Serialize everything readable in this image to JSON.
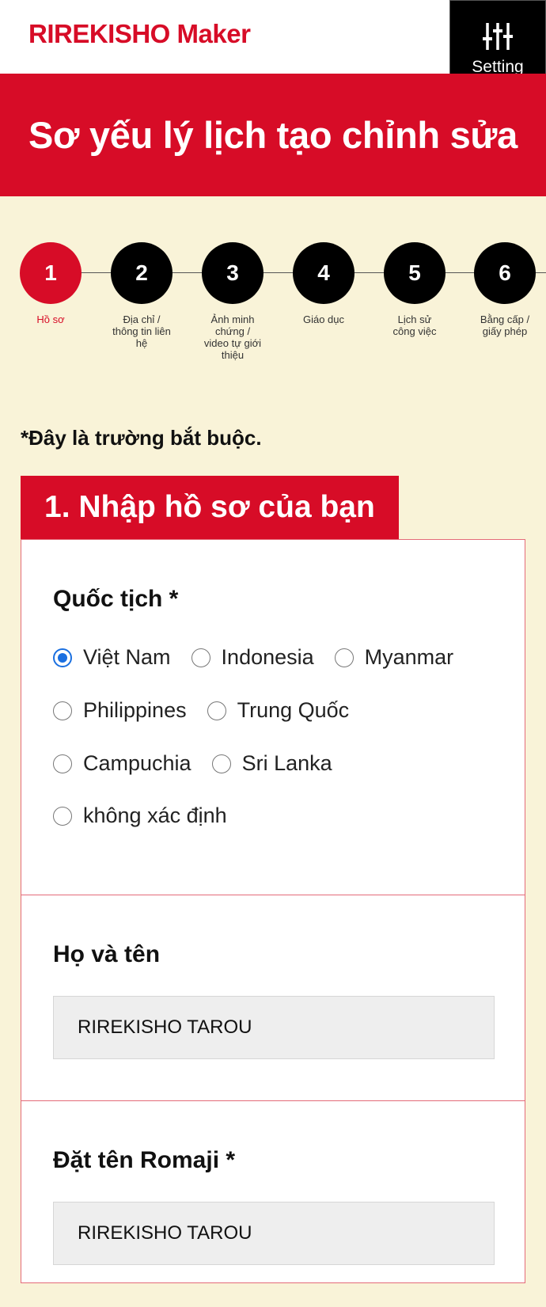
{
  "header": {
    "logo": "RIREKISHO Maker",
    "setting_label": "Setting",
    "setting_icon": "sliders-icon"
  },
  "banner": {
    "title": "Sơ yếu lý lịch tạo chỉnh sửa"
  },
  "steps": [
    {
      "number": "1",
      "label": "Hồ sơ",
      "active": true
    },
    {
      "number": "2",
      "label": "Địa chỉ / thông tin liên hệ",
      "active": false
    },
    {
      "number": "3",
      "label": "Ảnh minh chứng / video tự giới thiệu",
      "active": false
    },
    {
      "number": "4",
      "label": "Giáo dục",
      "active": false
    },
    {
      "number": "5",
      "label": "Lịch sử công việc",
      "active": false
    },
    {
      "number": "6",
      "label": "Bằng cấp / giấy phép",
      "active": false
    }
  ],
  "required_note": "*Đây là trường bắt buộc.",
  "section": {
    "title": "1. Nhập hồ sơ của bạn"
  },
  "nationality": {
    "title": "Quốc tịch *",
    "selected": "Việt Nam",
    "options": [
      "Việt Nam",
      "Indonesia",
      "Myanmar",
      "Philippines",
      "Trung Quốc",
      "Campuchia",
      "Sri Lanka",
      "không xác định"
    ]
  },
  "full_name": {
    "title": "Họ và tên",
    "value": "RIREKISHO TAROU"
  },
  "romaji_name": {
    "title": "Đặt tên Romaji *",
    "value": "RIREKISHO TAROU"
  },
  "colors": {
    "brand_red": "#d70c27",
    "background": "#f9f3d8",
    "radio_checked": "#1a6fe0"
  }
}
